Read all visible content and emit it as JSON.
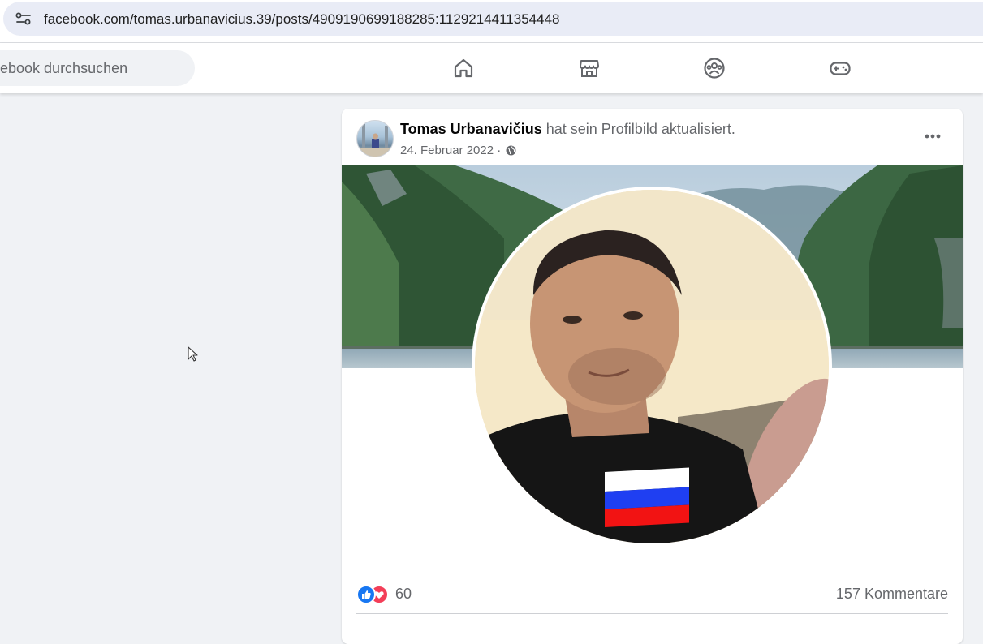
{
  "browser": {
    "url": "facebook.com/tomas.urbanavicius.39/posts/4909190699188285:1129214411354448"
  },
  "header": {
    "search_placeholder": "ebook durchsuchen",
    "nav_icons": [
      "home-icon",
      "marketplace-icon",
      "groups-icon",
      "gaming-icon"
    ]
  },
  "post": {
    "author": "Tomas Urbanavičius",
    "action": "hat sein Profilbild aktualisiert.",
    "date": "24. Februar 2022",
    "separator": "·",
    "privacy_icon": "globe-icon",
    "reactions_count": "60",
    "comments": "157 Kommentare"
  },
  "colors": {
    "brand_blue": "#1877f2",
    "love_red": "#f33e58",
    "page_bg": "#f0f2f5"
  }
}
